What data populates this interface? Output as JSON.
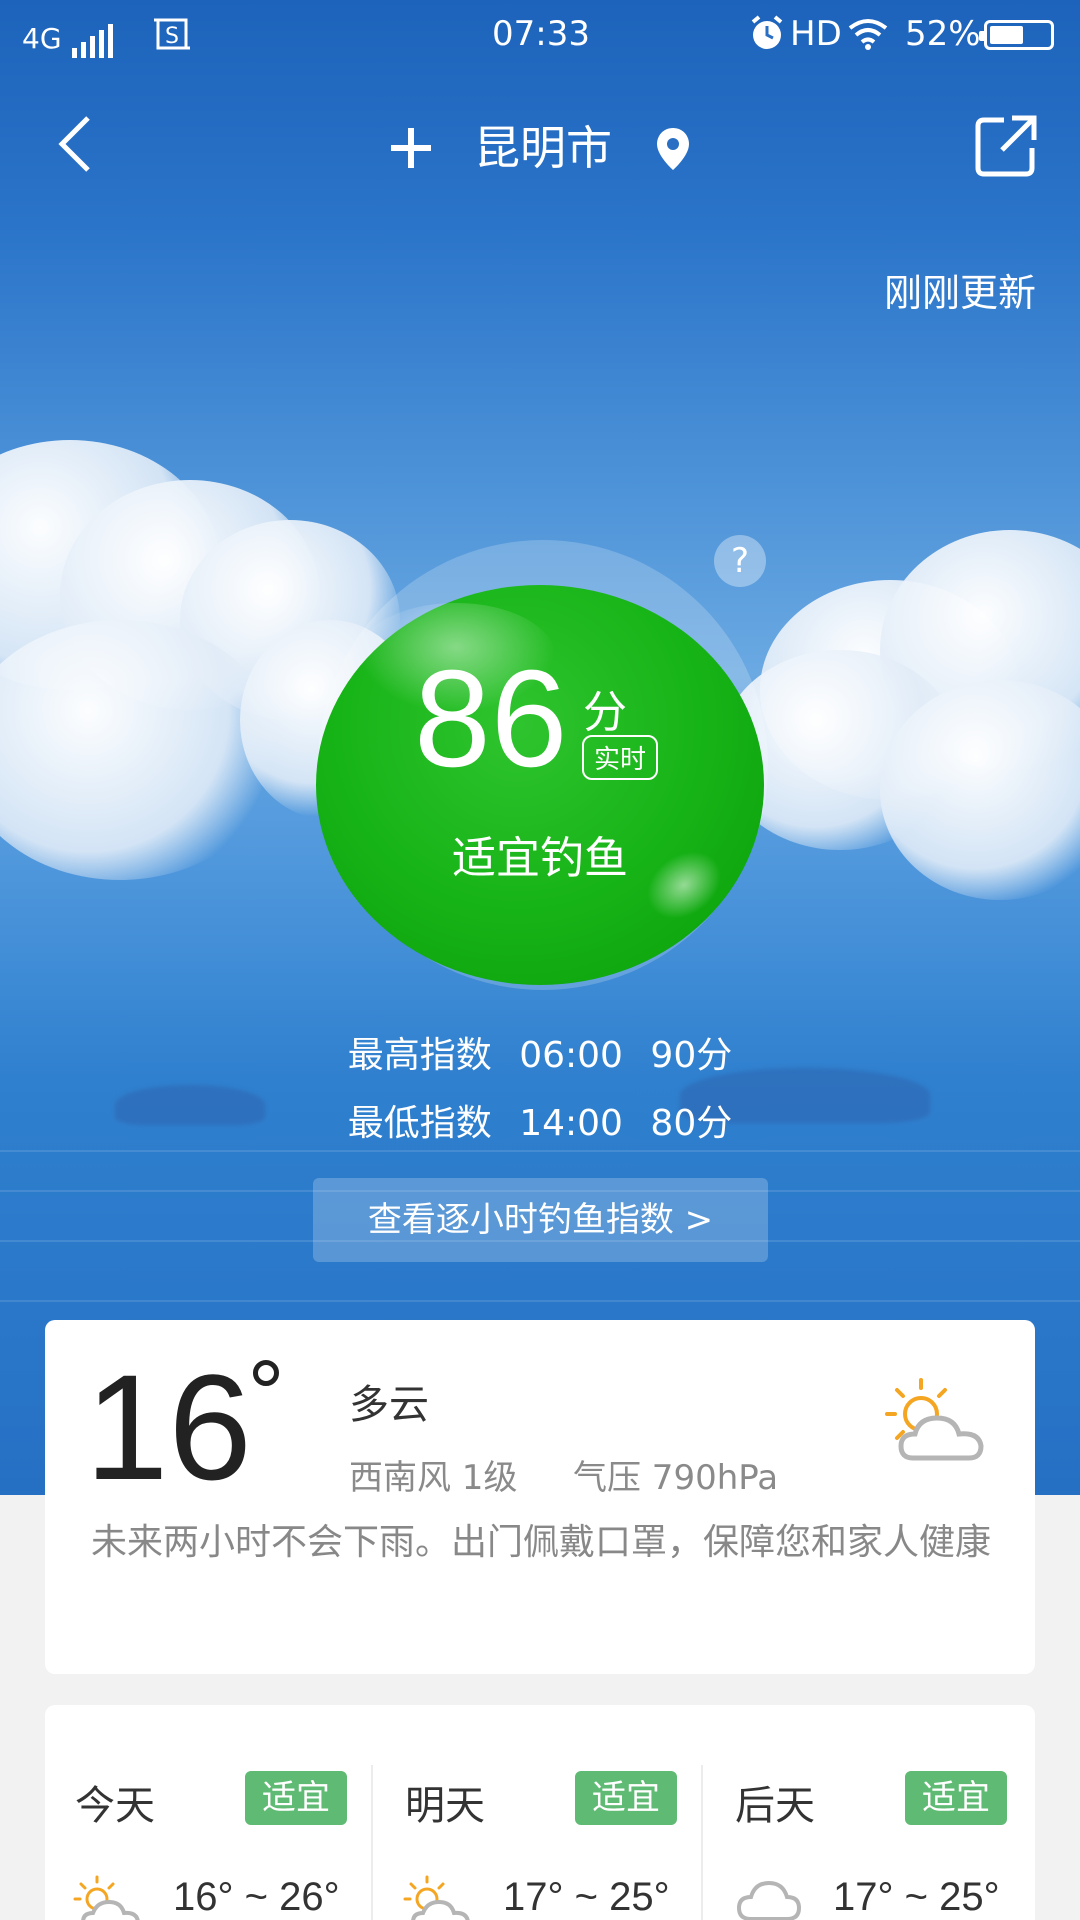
{
  "status_bar": {
    "network": "4G",
    "time": "07:33",
    "hd": "HD",
    "battery": "52%"
  },
  "header": {
    "city": "昆明市"
  },
  "updated_text": "刚刚更新",
  "fishing": {
    "score": "86",
    "unit": "分",
    "realtime_badge": "实时",
    "status": "适宜钓鱼",
    "ball_color": "#17b417"
  },
  "index": {
    "high": {
      "label": "最高指数",
      "time": "06:00",
      "value": "90分"
    },
    "low": {
      "label": "最低指数",
      "time": "14:00",
      "value": "80分"
    }
  },
  "hourly_button": "查看逐小时钓鱼指数  >",
  "current": {
    "temp": "16",
    "condition": "多云",
    "wind": "西南风  1级",
    "pressure": "气压  790hPa",
    "advice": "未来两小时不会下雨。出门佩戴口罩，保障您和家人健康",
    "icon": "partly-cloudy-icon"
  },
  "forecast": [
    {
      "day": "今天",
      "badge": "适宜",
      "range": "16° ~ 26°",
      "icon": "partly-cloudy-icon"
    },
    {
      "day": "明天",
      "badge": "适宜",
      "range": "17° ~ 25°",
      "icon": "partly-cloudy-icon"
    },
    {
      "day": "后天",
      "badge": "适宜",
      "range": "17° ~ 25°",
      "icon": "rain-cloud-icon"
    }
  ],
  "colors": {
    "badge_green": "#5fba73",
    "sky_blue": "#2a74c9"
  }
}
